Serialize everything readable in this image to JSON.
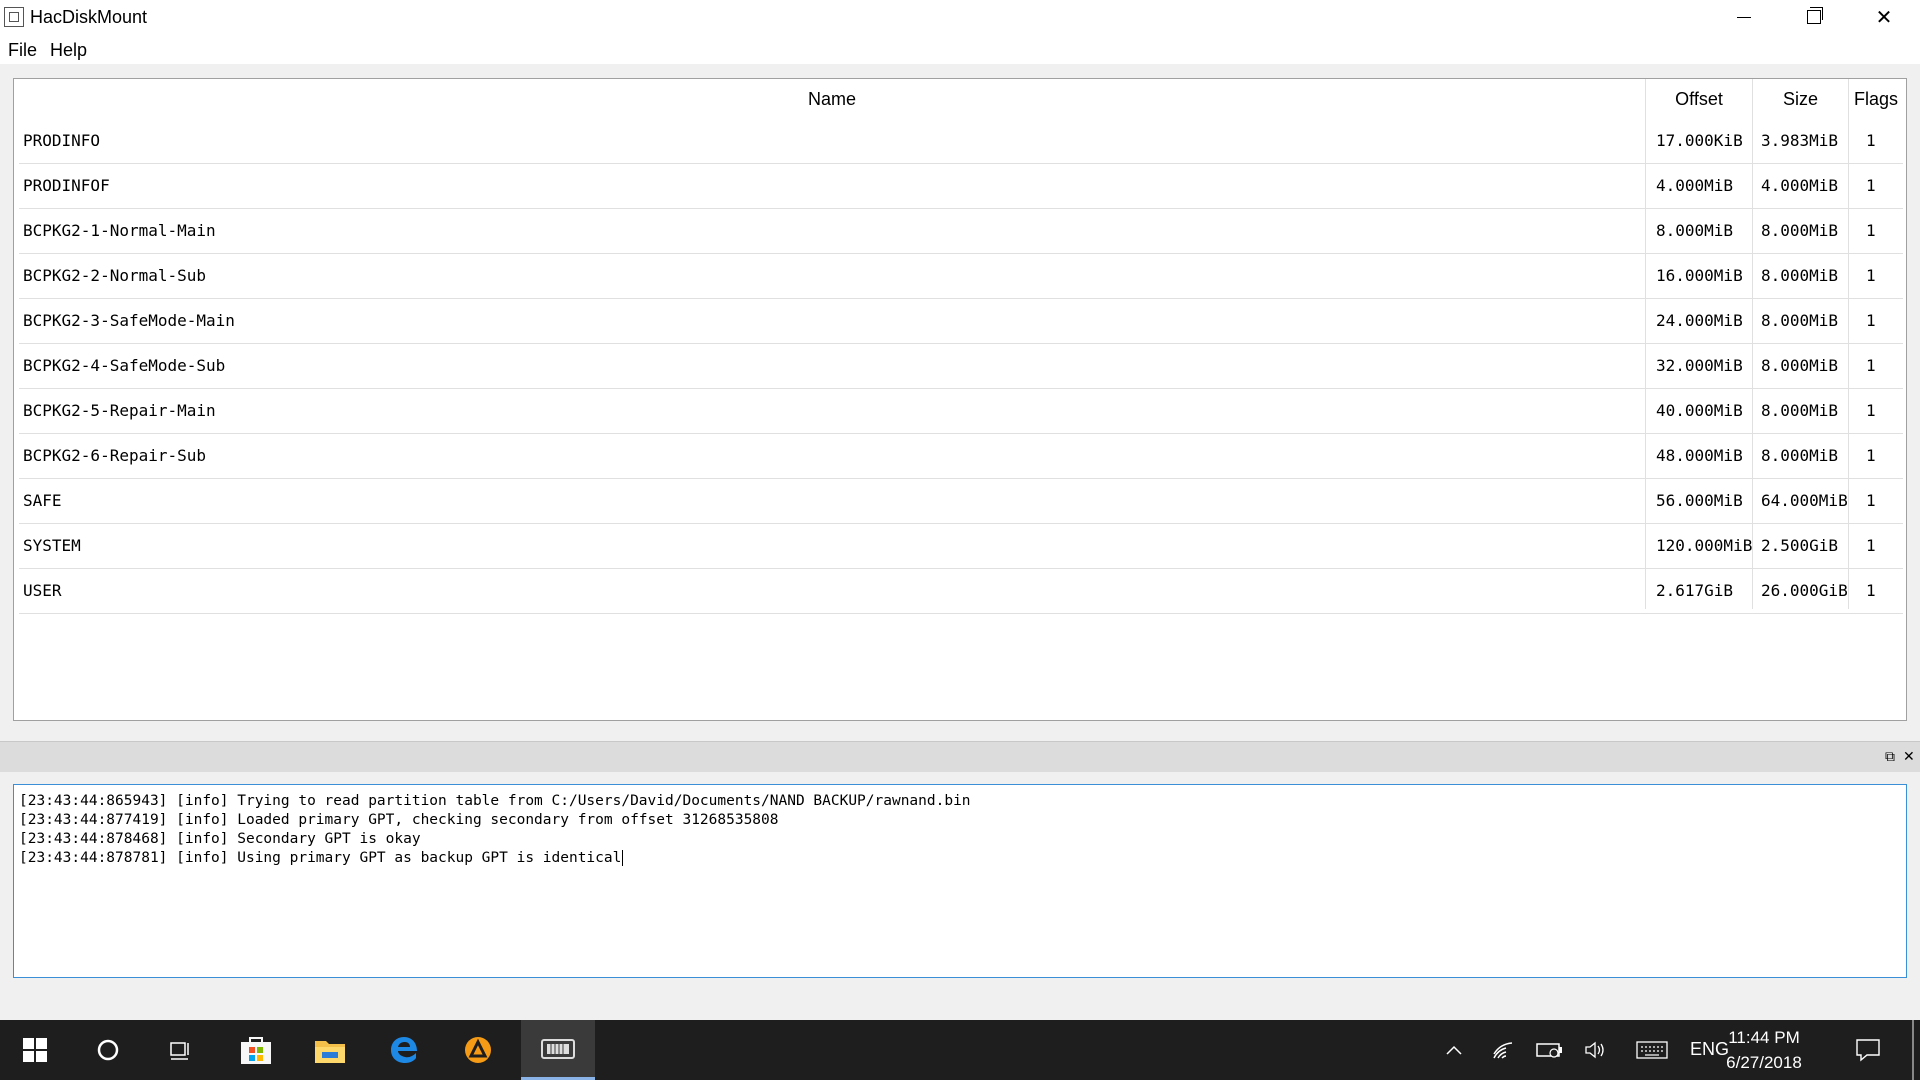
{
  "window": {
    "title": "HacDiskMount"
  },
  "menu": {
    "items": [
      "File",
      "Help"
    ]
  },
  "table": {
    "columns": [
      "Name",
      "Offset",
      "Size",
      "Flags"
    ],
    "rows": [
      {
        "name": "PRODINFO",
        "offset": "17.000KiB",
        "size": "3.983MiB",
        "flags": "1"
      },
      {
        "name": "PRODINFOF",
        "offset": "4.000MiB",
        "size": "4.000MiB",
        "flags": "1"
      },
      {
        "name": "BCPKG2-1-Normal-Main",
        "offset": "8.000MiB",
        "size": "8.000MiB",
        "flags": "1"
      },
      {
        "name": "BCPKG2-2-Normal-Sub",
        "offset": "16.000MiB",
        "size": "8.000MiB",
        "flags": "1"
      },
      {
        "name": "BCPKG2-3-SafeMode-Main",
        "offset": "24.000MiB",
        "size": "8.000MiB",
        "flags": "1"
      },
      {
        "name": "BCPKG2-4-SafeMode-Sub",
        "offset": "32.000MiB",
        "size": "8.000MiB",
        "flags": "1"
      },
      {
        "name": "BCPKG2-5-Repair-Main",
        "offset": "40.000MiB",
        "size": "8.000MiB",
        "flags": "1"
      },
      {
        "name": "BCPKG2-6-Repair-Sub",
        "offset": "48.000MiB",
        "size": "8.000MiB",
        "flags": "1"
      },
      {
        "name": "SAFE",
        "offset": "56.000MiB",
        "size": "64.000MiB",
        "flags": "1"
      },
      {
        "name": "SYSTEM",
        "offset": "120.000MiB",
        "size": "2.500GiB",
        "flags": "1"
      },
      {
        "name": "USER",
        "offset": "2.617GiB",
        "size": "26.000GiB",
        "flags": "1"
      }
    ]
  },
  "log": {
    "lines": [
      "[23:43:44:865943] [info] Trying to read partition table from C:/Users/David/Documents/NAND BACKUP/rawnand.bin",
      "[23:43:44:877419] [info] Loaded primary GPT, checking secondary from offset 31268535808",
      "[23:43:44:878468] [info] Secondary GPT is okay",
      "[23:43:44:878781] [info] Using primary GPT as backup GPT is identical"
    ]
  },
  "taskbar": {
    "apps": [
      "start-icon",
      "cortana-icon",
      "task-view-icon",
      "store-icon",
      "file-explorer-icon",
      "edge-icon",
      "vlc-icon",
      "hacdiskmount-icon"
    ],
    "tray": {
      "language": "ENG",
      "time": "11:44 PM",
      "date": "6/27/2018"
    }
  }
}
